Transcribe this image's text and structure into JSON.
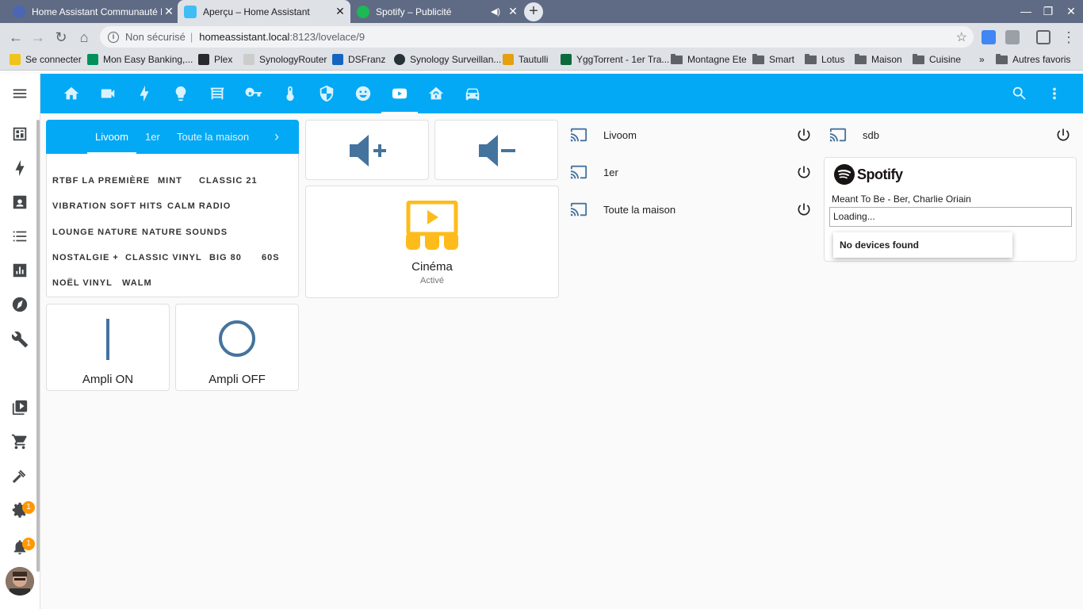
{
  "browser": {
    "tabs": [
      {
        "title": "Home Assistant Communauté Fr",
        "active": false
      },
      {
        "title": "Aperçu – Home Assistant",
        "active": true
      },
      {
        "title": "Spotify – Publicité",
        "active": false
      }
    ],
    "address": {
      "security": "Non sécurisé",
      "host": "homeassistant.local",
      "port_path": ":8123/lovelace/9"
    },
    "bookmarks": [
      {
        "label": "Se connecter",
        "color": "#f0c419"
      },
      {
        "label": "Mon Easy Banking,...",
        "color": "#00915a"
      },
      {
        "label": "Plex",
        "color": "#282a2d"
      },
      {
        "label": "SynologyRouter",
        "color": "#cccccc"
      },
      {
        "label": "DSFranz",
        "color": "#1565c0"
      },
      {
        "label": "Synology Surveillan...",
        "color": "#263238"
      },
      {
        "label": "Tautulli",
        "color": "#e5a00d"
      },
      {
        "label": "YggTorrent - 1er Tra...",
        "color": "#0b6b3a"
      },
      {
        "label": "Montagne Ete",
        "folder": true
      },
      {
        "label": "Smart",
        "folder": true
      },
      {
        "label": "Lotus",
        "folder": true
      },
      {
        "label": "Maison",
        "folder": true
      },
      {
        "label": "Cuisine",
        "folder": true
      }
    ],
    "bookmarks_more": "»",
    "other_bookmarks": "Autres favoris"
  },
  "sidebar": {
    "badges": [
      "1",
      "1"
    ]
  },
  "radio": {
    "tabs": [
      "Livoom",
      "1er",
      "Toute la maison"
    ],
    "stations": [
      [
        "RTBF LA PREMIÈRE",
        "MINT",
        "CLASSIC 21"
      ],
      [
        "VIBRATION SOFT HITS",
        "CALM RADIO"
      ],
      [
        "LOUNGE NATURE",
        "NATURE SOUNDS"
      ],
      [
        "NOSTALGIE +",
        "CLASSIC VINYL",
        "BIG 80",
        "60S"
      ],
      [
        "NOËL VINYL",
        "WALM"
      ]
    ]
  },
  "ampli": {
    "on_label": "Ampli ON",
    "off_label": "Ampli OFF"
  },
  "scene": {
    "name": "Cinéma",
    "state": "Activé",
    "icon_color": "#fdbc1b"
  },
  "media_players": {
    "col1": [
      "Livoom",
      "1er",
      "Toute la maison"
    ],
    "col2": [
      "sdb"
    ]
  },
  "spotify": {
    "brand": "Spotify",
    "playlist": "Meant To Be - Ber, Charlie Oriain",
    "select_value": "Loading...",
    "dropdown_text": "No devices found"
  },
  "colors": {
    "primary": "#03a9f4",
    "icon_blue": "#44739e",
    "badge": "#ff9800"
  }
}
